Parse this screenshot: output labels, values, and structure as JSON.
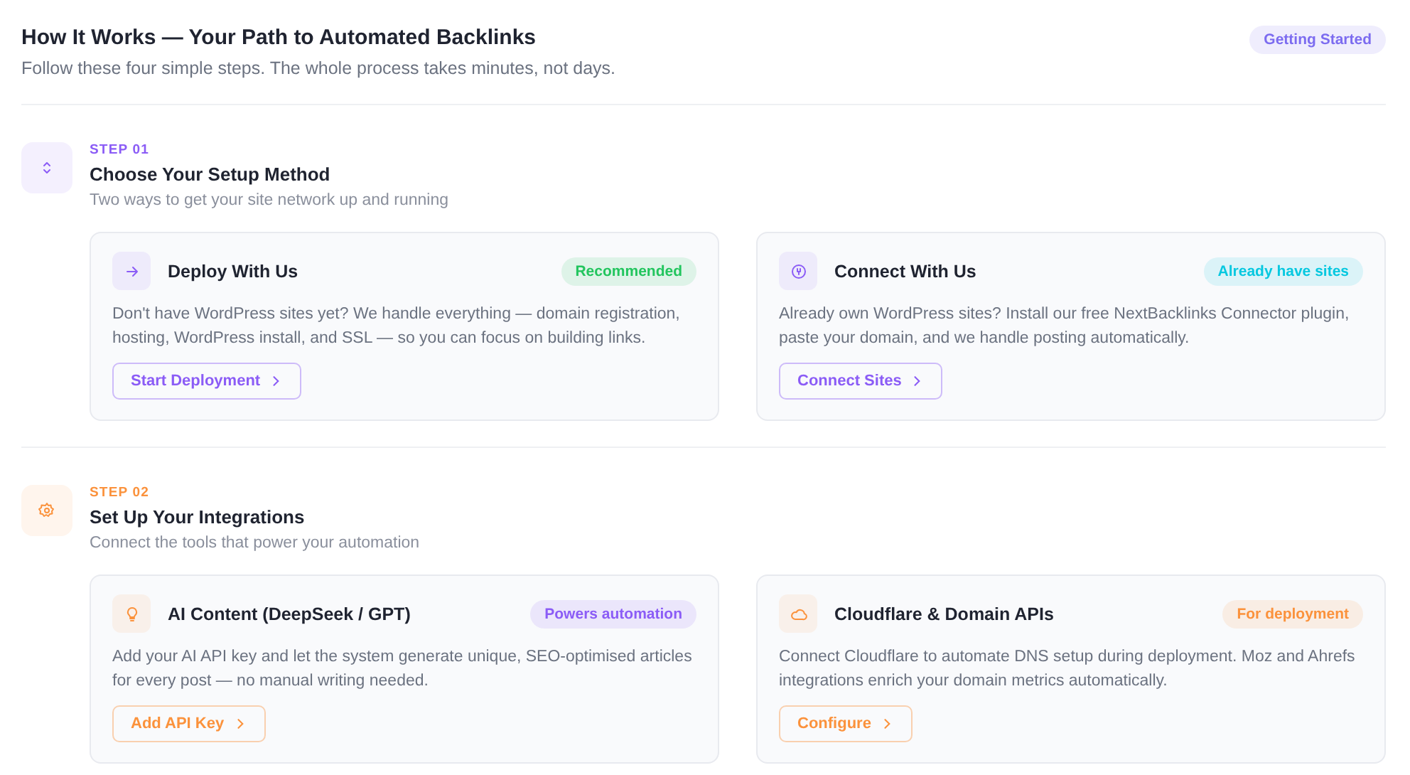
{
  "header": {
    "title": "How It Works — Your Path to Automated Backlinks",
    "subtitle": "Follow these four simple steps. The whole process takes minutes, not days.",
    "badge": "Getting Started"
  },
  "steps": [
    {
      "label": "STEP 01",
      "title": "Choose Your Setup Method",
      "subtitle": "Two ways to get your site network up and running",
      "color": "#8b5cf6",
      "cards": [
        {
          "title": "Deploy With Us",
          "badge": "Recommended",
          "color": "#22c55e",
          "text": "Don't have WordPress sites yet? We handle everything — domain registration, hosting, WordPress install, and SSL — so you can focus on building links.",
          "button": "Start Deployment"
        },
        {
          "title": "Connect With Us",
          "badge": "Already have sites",
          "color": "#06c8e0",
          "text": "Already own WordPress sites? Install our free NextBacklinks Connector plugin, paste your domain, and we handle posting automatically.",
          "button": "Connect Sites"
        }
      ]
    },
    {
      "label": "STEP 02",
      "title": "Set Up Your Integrations",
      "subtitle": "Connect the tools that power your automation",
      "color": "#fb923c",
      "cards": [
        {
          "title": "AI Content (DeepSeek / GPT)",
          "badge": "Powers automation",
          "color": "#8b5cf6",
          "text": "Add your AI API key and let the system generate unique, SEO-optimised articles for every post — no manual writing needed.",
          "button": "Add API Key"
        },
        {
          "title": "Cloudflare & Domain APIs",
          "badge": "For deployment",
          "color": "#fb923c",
          "text": "Connect Cloudflare to automate DNS setup during deployment. Moz and Ahrefs integrations enrich your domain metrics automatically.",
          "button": "Configure"
        }
      ]
    }
  ]
}
